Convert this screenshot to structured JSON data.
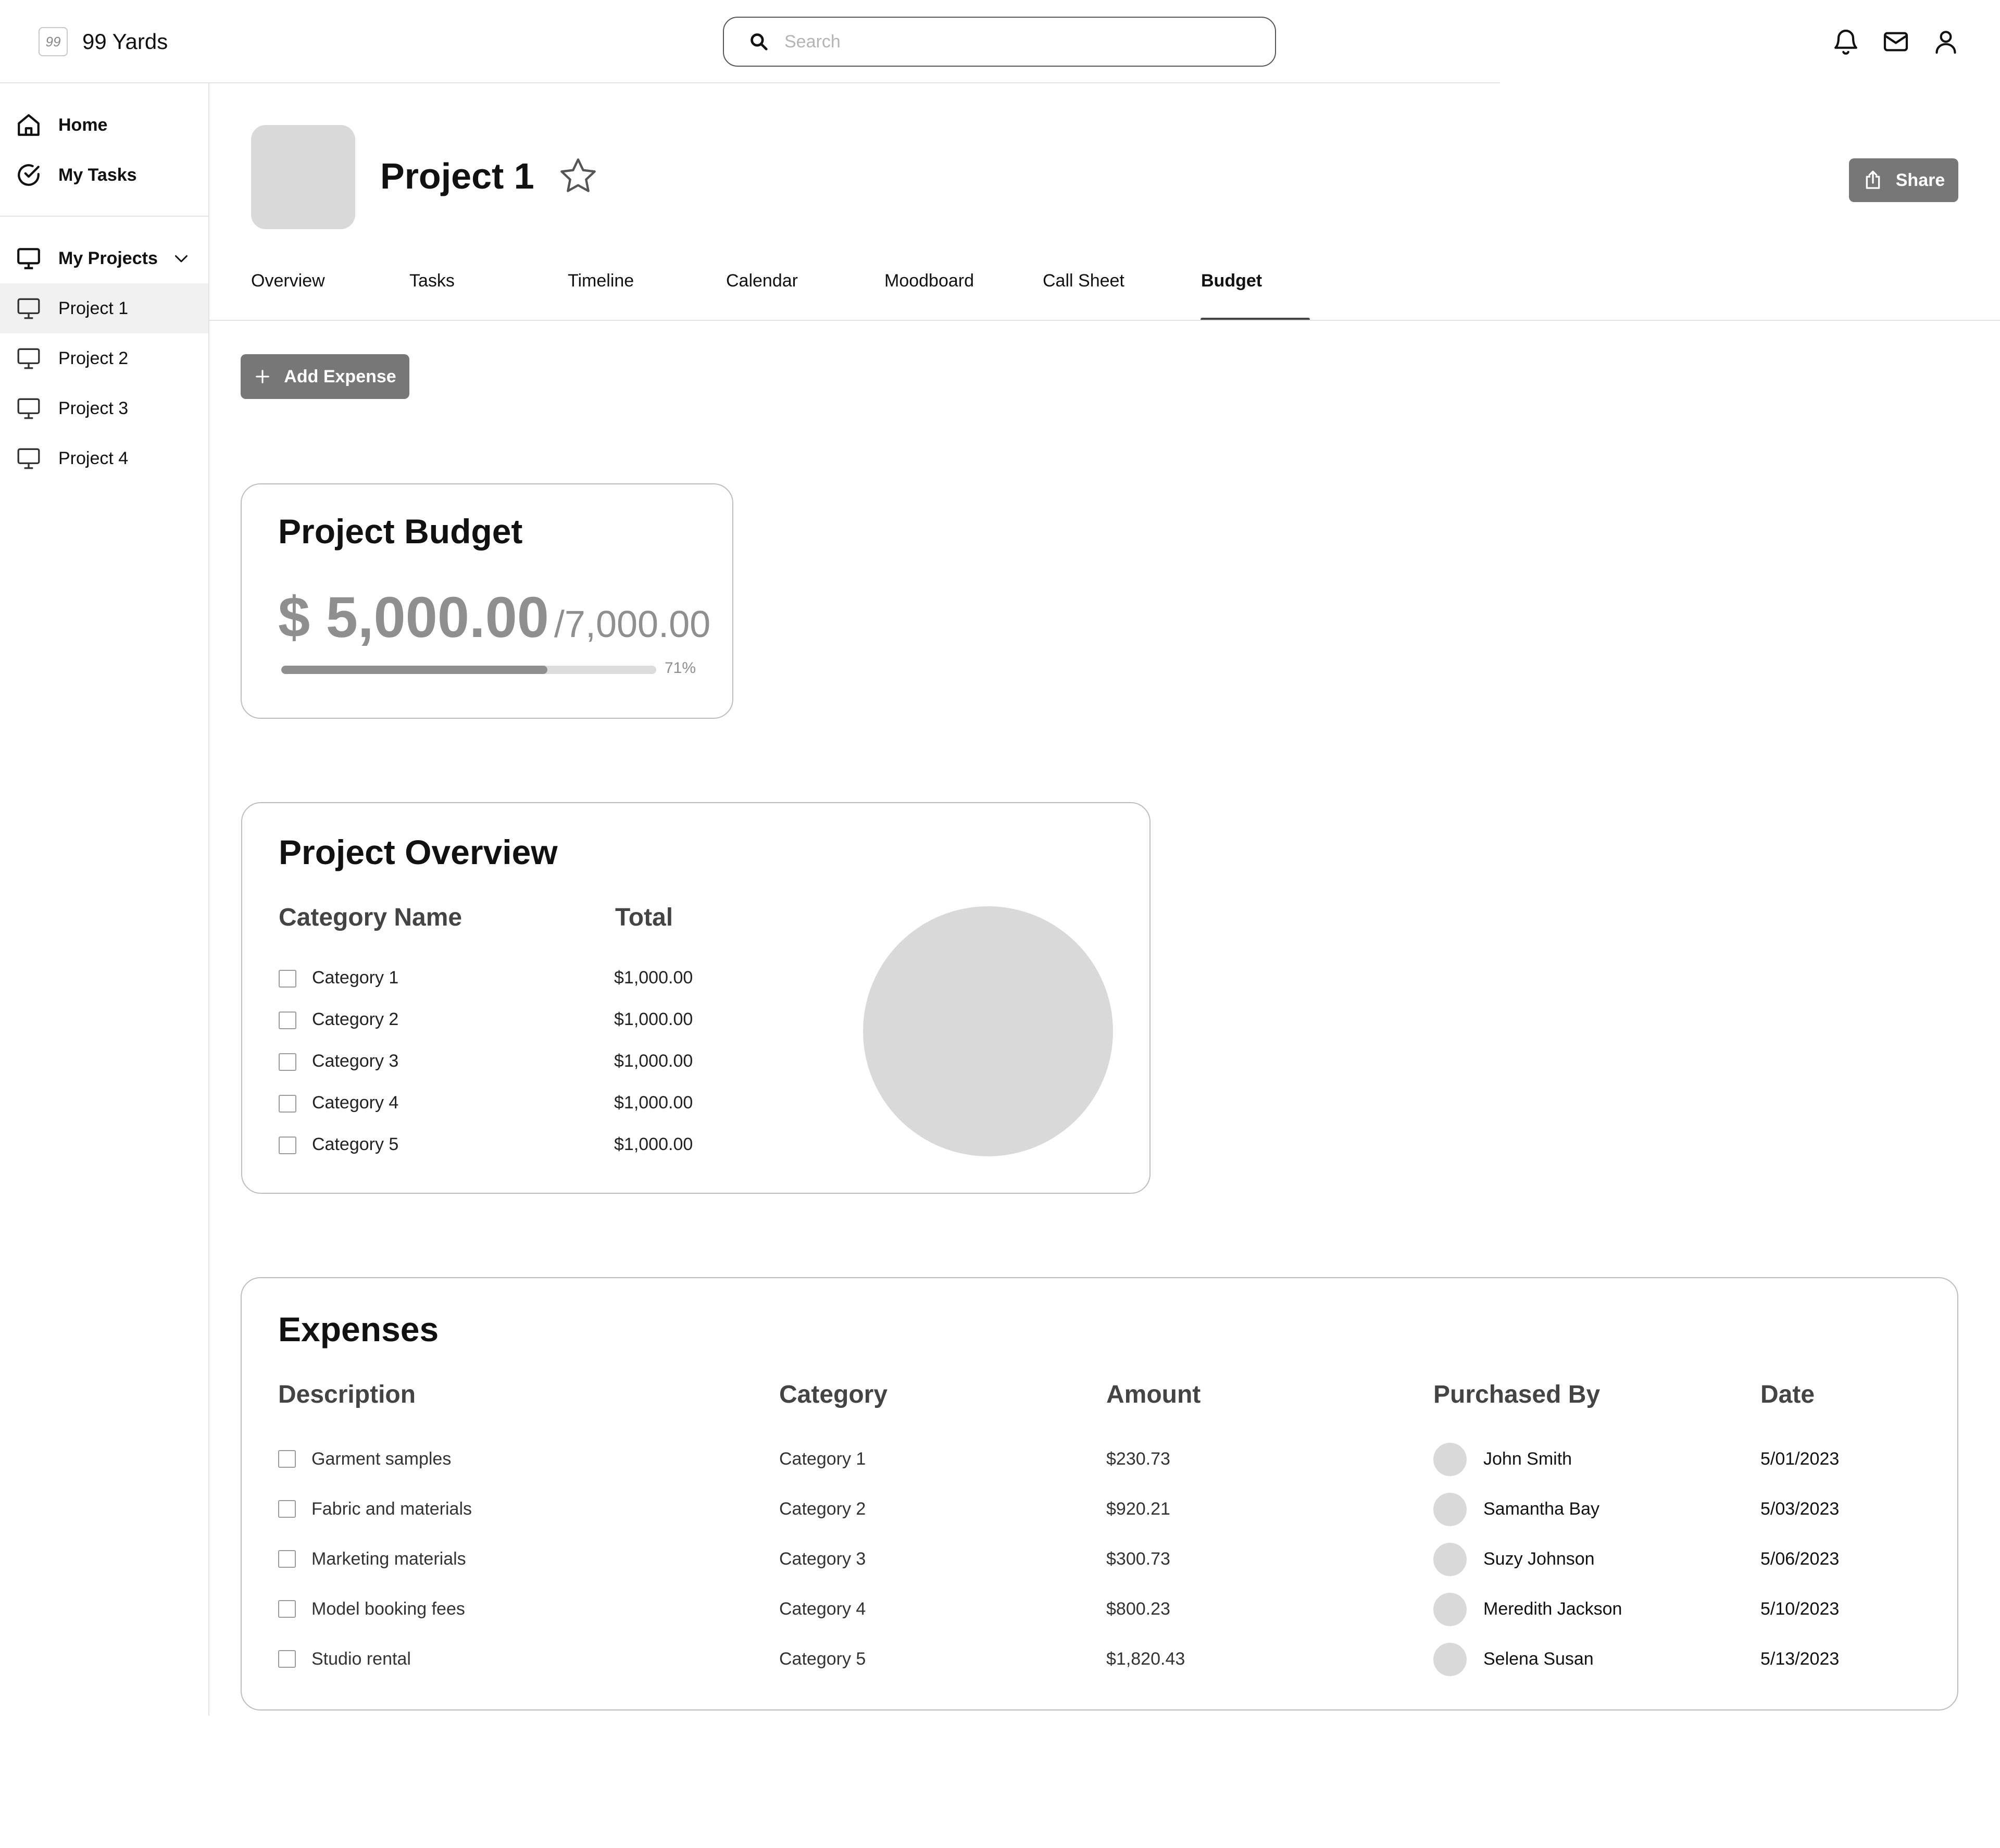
{
  "app": {
    "name": "99 Yards",
    "logo_glyph": "99"
  },
  "search": {
    "placeholder": "Search"
  },
  "topbar": {
    "icons": [
      "bell-icon",
      "mail-icon",
      "user-icon"
    ]
  },
  "sidebar": {
    "home": "Home",
    "my_tasks": "My Tasks",
    "my_projects": "My Projects",
    "projects": [
      {
        "label": "Project 1",
        "active": true
      },
      {
        "label": "Project 2",
        "active": false
      },
      {
        "label": "Project 3",
        "active": false
      },
      {
        "label": "Project 4",
        "active": false
      }
    ]
  },
  "header": {
    "title": "Project 1",
    "share_label": "Share"
  },
  "tabs": [
    {
      "label": "Overview",
      "active": false
    },
    {
      "label": "Tasks",
      "active": false
    },
    {
      "label": "Timeline",
      "active": false
    },
    {
      "label": "Calendar",
      "active": false
    },
    {
      "label": "Moodboard",
      "active": false
    },
    {
      "label": "Call Sheet",
      "active": false
    },
    {
      "label": "Budget",
      "active": true
    }
  ],
  "actions": {
    "add_expense": "Add Expense"
  },
  "budget": {
    "title": "Project Budget",
    "spent": "$ 5,000.00",
    "total": "/7,000.00",
    "percent_label": "71%",
    "progress": 0.71
  },
  "overview": {
    "title": "Project Overview",
    "col_category": "Category Name",
    "col_total": "Total",
    "rows": [
      {
        "category": "Category 1",
        "total": "$1,000.00"
      },
      {
        "category": "Category 2",
        "total": "$1,000.00"
      },
      {
        "category": "Category 3",
        "total": "$1,000.00"
      },
      {
        "category": "Category 4",
        "total": "$1,000.00"
      },
      {
        "category": "Category 5",
        "total": "$1,000.00"
      }
    ]
  },
  "expenses": {
    "title": "Expenses",
    "columns": [
      "Description",
      "Category",
      "Amount",
      "Purchased By",
      "Date"
    ],
    "rows": [
      {
        "description": "Garment samples",
        "category": "Category 1",
        "amount": "$230.73",
        "purchased_by": "John Smith",
        "date": "5/01/2023"
      },
      {
        "description": "Fabric and materials",
        "category": "Category 2",
        "amount": "$920.21",
        "purchased_by": "Samantha Bay",
        "date": "5/03/2023"
      },
      {
        "description": "Marketing materials",
        "category": "Category 3",
        "amount": "$300.73",
        "purchased_by": "Suzy Johnson",
        "date": "5/06/2023"
      },
      {
        "description": "Model booking  fees",
        "category": "Category 4",
        "amount": "$800.23",
        "purchased_by": "Meredith Jackson",
        "date": "5/10/2023"
      },
      {
        "description": "Studio rental",
        "category": "Category 5",
        "amount": "$1,820.43",
        "purchased_by": "Selena Susan",
        "date": "5/13/2023"
      }
    ]
  },
  "colors": {
    "button_bg": "#777777",
    "placeholder_gray": "#d9d9d9",
    "text_muted": "#8f8f8f",
    "border": "#bdbdbd"
  }
}
